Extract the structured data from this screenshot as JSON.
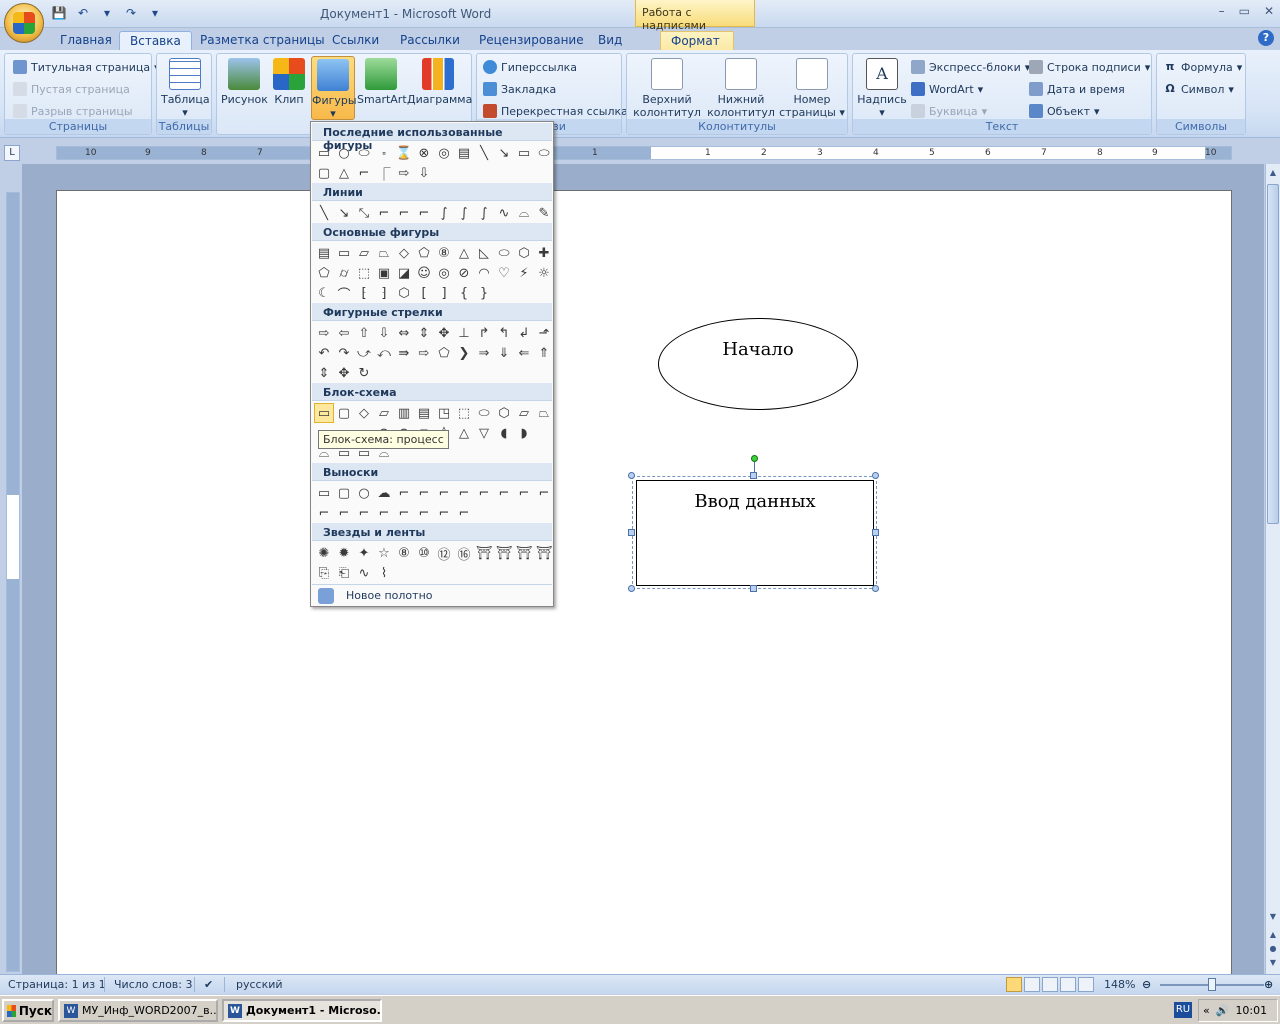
{
  "window": {
    "title": "Документ1 - Microsoft Word",
    "context_header": "Работа с надписями",
    "controls": [
      "–",
      "▭",
      "✕"
    ]
  },
  "qat": [
    "💾",
    "↶",
    "▾",
    "↷",
    "▾"
  ],
  "tabs": [
    {
      "label": "Главная"
    },
    {
      "label": "Вставка"
    },
    {
      "label": "Разметка страницы"
    },
    {
      "label": "Ссылки"
    },
    {
      "label": "Рассылки"
    },
    {
      "label": "Рецензирование"
    },
    {
      "label": "Вид"
    },
    {
      "label": "Формат"
    }
  ],
  "ribbon": {
    "pages": {
      "label": "Страницы",
      "cover": "Титульная страница",
      "blank": "Пустая страница",
      "break": "Разрыв страницы"
    },
    "tables": {
      "label": "Таблицы",
      "table": "Таблица"
    },
    "illustrations": {
      "picture": "Рисунок",
      "clip": "Клип",
      "shapes": "Фигуры",
      "smartart": "SmartArt",
      "chart": "Диаграмма"
    },
    "links": {
      "label": "Связи",
      "hyperlink": "Гиперссылка",
      "bookmark": "Закладка",
      "crossref": "Перекрестная ссылка"
    },
    "headers": {
      "label": "Колонтитулы",
      "header_l1": "Верхний",
      "header_l2": "колонтитул",
      "footer_l1": "Нижний",
      "footer_l2": "колонтитул",
      "pagenum_l1": "Номер",
      "pagenum_l2": "страницы"
    },
    "text": {
      "label": "Текст",
      "textbox": "Надпись",
      "quickparts": "Экспресс-блоки",
      "wordart": "WordArt",
      "dropcap": "Буквица",
      "signature": "Строка подписи",
      "datetime": "Дата и время",
      "object": "Объект"
    },
    "symbols": {
      "label": "Символы",
      "equation": "Формула",
      "symbol": "Символ"
    }
  },
  "ruler": {
    "left_ticks": [
      "10",
      "9",
      "8",
      "7"
    ],
    "right_ticks": [
      "1",
      "1",
      "2",
      "3",
      "4",
      "5",
      "6",
      "7",
      "8",
      "9",
      "10"
    ]
  },
  "shapes_menu": {
    "sections": {
      "recent": "Последние использованные фигуры",
      "lines": "Линии",
      "basic": "Основные фигуры",
      "arrows": "Фигурные стрелки",
      "flowchart": "Блок-схема",
      "callouts": "Выноски",
      "stars": "Звезды и ленты"
    },
    "recent_row1": [
      "▭",
      "○",
      "⬭",
      "⬞",
      "⌛",
      "⊗",
      "◎",
      "▤",
      "╲",
      "↘",
      "▭",
      "⬭"
    ],
    "recent_row2": [
      "▢",
      "△",
      "⌐",
      "⎾",
      "⇨",
      "⇩"
    ],
    "lines_row": [
      "╲",
      "↘",
      "⤡",
      "⌐",
      "⌐",
      "⌐",
      "∫",
      "∫",
      "∫",
      "∿",
      "⌓",
      "✎"
    ],
    "basic_row1": [
      "▤",
      "▭",
      "▱",
      "⏢",
      "◇",
      "⬠",
      "⑧",
      "△",
      "◺",
      "⬭",
      "⬡",
      "✚"
    ],
    "basic_row2": [
      "⬠",
      "⌭",
      "⬚",
      "▣",
      "◪",
      "☺",
      "◎",
      "⊘",
      "◠",
      "♡",
      "⚡",
      "☼"
    ],
    "basic_row3": [
      "☾",
      "⌒",
      "⁅",
      "⁆",
      "⬡",
      "[",
      "]",
      "{",
      "}"
    ],
    "arrows_row1": [
      "⇨",
      "⇦",
      "⇧",
      "⇩",
      "⇔",
      "⇕",
      "✥",
      "⊥",
      "↱",
      "↰",
      "↲",
      "⬏"
    ],
    "arrows_row2": [
      "↶",
      "↷",
      "⤻",
      "⤺",
      "⇛",
      "⇨",
      "⬠",
      "❯",
      "⇒",
      "⇓",
      "⇐",
      "⇑"
    ],
    "arrows_row3": [
      "⇕",
      "✥",
      "↻"
    ],
    "flow_row1": [
      "▭",
      "▢",
      "◇",
      "▱",
      "▥",
      "▤",
      "◳",
      "⬚",
      "⬭",
      "⬡",
      "⏥",
      "⏢"
    ],
    "flow_row2": [
      "⌓",
      "⌓",
      "⌓",
      "⊗",
      "⊕",
      "⧖",
      "◊",
      "△",
      "▽",
      "◖",
      "◗"
    ],
    "flow_row3": [
      "⌓",
      "▭",
      "▭",
      "⌓"
    ],
    "callouts_row1": [
      "▭",
      "▢",
      "○",
      "☁",
      "⌐",
      "⌐",
      "⌐",
      "⌐",
      "⌐",
      "⌐",
      "⌐",
      "⌐"
    ],
    "callouts_row2": [
      "⌐",
      "⌐",
      "⌐",
      "⌐",
      "⌐",
      "⌐",
      "⌐",
      "⌐"
    ],
    "stars_row1": [
      "✺",
      "✹",
      "✦",
      "☆",
      "⑧",
      "⑩",
      "⑫",
      "⑯",
      "⛩",
      "⛩",
      "⛩",
      "⛩"
    ],
    "stars_row2": [
      "⎘",
      "⎗",
      "∿",
      "⌇"
    ],
    "tooltip": "Блок-схема: процесс",
    "new_canvas": "Новое полотно"
  },
  "document": {
    "shape1_text": "Начало",
    "shape2_text": "Ввод данных"
  },
  "status": {
    "page": "Страница: 1 из 1",
    "words": "Число слов: 3",
    "language": "русский",
    "zoom": "148%"
  },
  "taskbar": {
    "start": "Пуск",
    "task1": "МУ_Инф_WORD2007_в...",
    "task2": "Документ1 - Microso...",
    "lang": "RU",
    "time": "10:01"
  }
}
